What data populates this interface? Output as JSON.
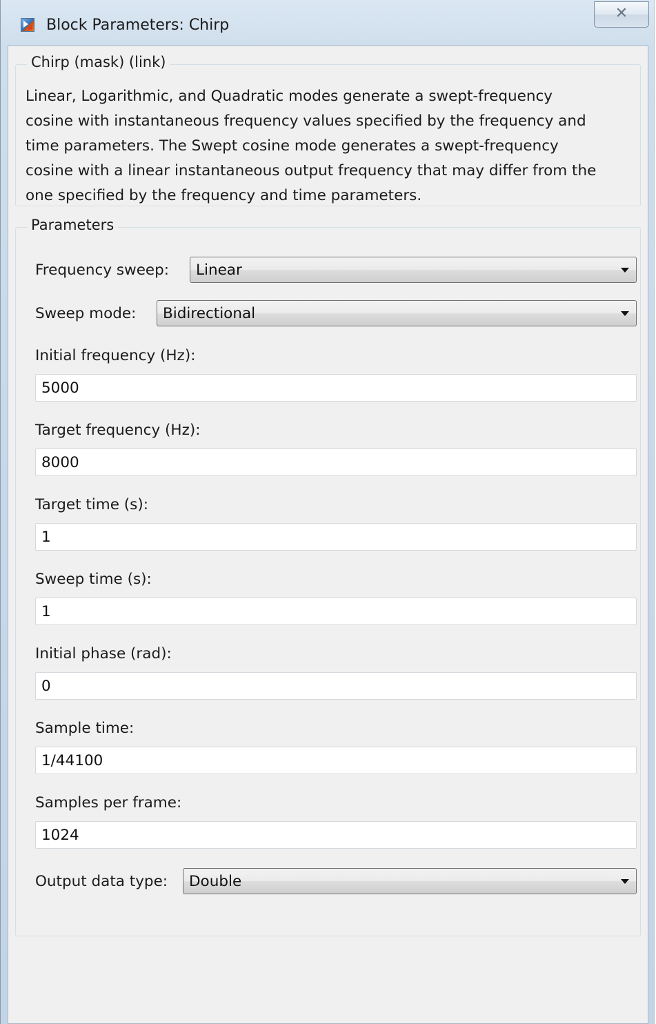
{
  "window": {
    "title": "Block Parameters: Chirp",
    "close_symbol": "✕"
  },
  "mask_group": {
    "label": "Chirp (mask) (link)",
    "description_lines": [
      "Linear, Logarithmic, and Quadratic modes generate a swept-frequency",
      "cosine with instantaneous frequency values specified by the frequency and",
      "time parameters.   The Swept cosine mode generates a swept-frequency",
      "cosine with a linear instantaneous output frequency that may differ from the",
      "one specified by the frequency and time parameters."
    ]
  },
  "parameters": {
    "label": "Parameters",
    "frequency_sweep": {
      "label": "Frequency sweep:",
      "value": "Linear"
    },
    "sweep_mode": {
      "label": "Sweep mode:",
      "value": "Bidirectional"
    },
    "initial_frequency": {
      "label": "Initial frequency (Hz):",
      "value": "5000"
    },
    "target_frequency": {
      "label": "Target frequency (Hz):",
      "value": "8000"
    },
    "target_time": {
      "label": "Target time (s):",
      "value": "1"
    },
    "sweep_time": {
      "label": "Sweep time (s):",
      "value": "1"
    },
    "initial_phase": {
      "label": "Initial phase (rad):",
      "value": "0"
    },
    "sample_time": {
      "label": "Sample time:",
      "value": "1/44100"
    },
    "samples_per_frame": {
      "label": "Samples per frame:",
      "value": "1024"
    },
    "output_data_type": {
      "label": "Output data type:",
      "value": "Double"
    }
  }
}
